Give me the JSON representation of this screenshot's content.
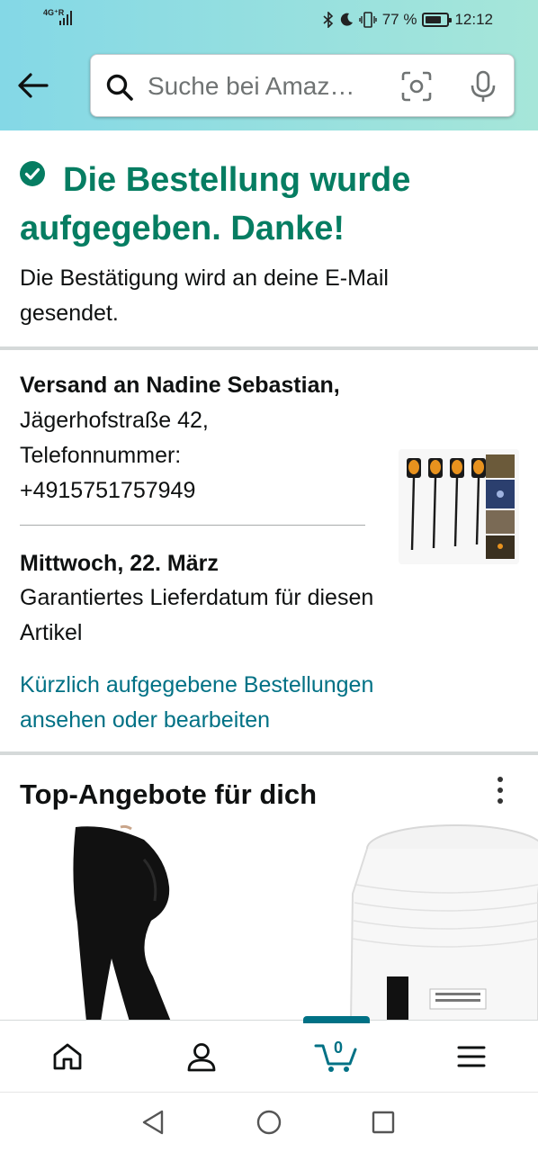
{
  "status_bar": {
    "network": "4G⁺R",
    "battery_percent": "77 %",
    "battery_level": 0.77,
    "time": "12:12"
  },
  "search": {
    "placeholder": "Suche bei Amaz…"
  },
  "confirmation": {
    "title": "Die Bestellung wurde aufgegeben. Danke!",
    "subtitle": "Die Bestätigung wird an deine E-Mail gesendet.",
    "accent_color": "#067D62"
  },
  "shipping": {
    "label_bold": "Versand an Nadine Sebastian,",
    "address": " Jägerhofstraße 42, Telefonnummer: +4915751757949",
    "delivery_date": "Mittwoch, 22. März",
    "delivery_note": "Garantiertes Lieferdatum für diesen Artikel",
    "orders_link": "Kürzlich aufgegebene Bestellungen ansehen oder bearbeiten",
    "link_color": "#007185"
  },
  "deals": {
    "title": "Top-Angebote für dich"
  },
  "bottom_nav": {
    "items": [
      "home-icon",
      "account-icon",
      "cart-icon",
      "menu-icon"
    ],
    "cart_count": "0",
    "active": "cart-icon"
  },
  "system_nav": {
    "items": [
      "back-triangle-icon",
      "home-circle-icon",
      "recents-square-icon"
    ]
  }
}
